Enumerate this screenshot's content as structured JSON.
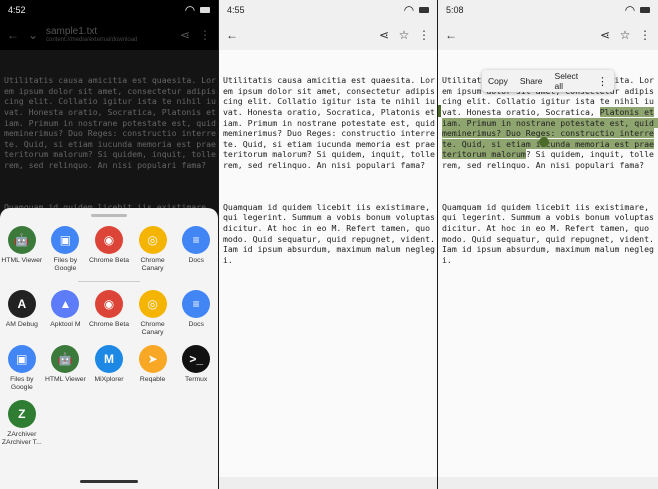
{
  "panel1": {
    "status": {
      "time": "4:52"
    },
    "appbar": {
      "title": "sample1.txt",
      "subtitle": "content://media/external/download"
    },
    "text": [
      "Utilitatis causa amicitia est quaesita. Lorem ipsum dolor sit amet, consectetur adipiscing elit. Collatio igitur ista te nihil iuvat. Honesta oratio, Socratica, Platonis etiam. Primum in nostrane potestate est, quid meminerimus? Duo Reges: constructio interrete. Quid, si etiam iucunda memoria est praeteritorum malorum? Si quidem, inquit, tollerem, sed relinquo. An nisi populari fama?",
      "Quamquam id quidem licebit iis existimare, qui legerint. Summum a vobis bonum voluptas dicitur. At hoc in eo M. Refert tamen, quo modo. Quid sequatur, quid repugnet, vident. Iam id ipsum absurdum, maximum malum neglegi."
    ],
    "share_apps_row1": [
      {
        "label": "HTML Viewer",
        "icon": "android-icon",
        "color": "#3c7a3c"
      },
      {
        "label": "Files by Google",
        "icon": "files-icon",
        "color": "#4285f4"
      },
      {
        "label": "Chrome Beta",
        "icon": "chrome-icon",
        "color": "#db4437"
      },
      {
        "label": "Chrome Canary",
        "icon": "chrome-canary-icon",
        "color": "#f4b400"
      },
      {
        "label": "Docs",
        "icon": "docs-icon",
        "color": "#4285f4"
      }
    ],
    "share_apps_row2": [
      {
        "label": "AM Debug",
        "icon": "am-icon",
        "color": "#222222"
      },
      {
        "label": "Apktool M",
        "icon": "apktool-icon",
        "color": "#5c7cfa"
      },
      {
        "label": "Chrome Beta",
        "icon": "chrome-icon",
        "color": "#db4437"
      },
      {
        "label": "Chrome Canary",
        "icon": "chrome-canary-icon",
        "color": "#f4b400"
      },
      {
        "label": "Docs",
        "icon": "docs-icon",
        "color": "#4285f4"
      }
    ],
    "share_apps_row3": [
      {
        "label": "Files by Google",
        "icon": "files-icon",
        "color": "#4285f4"
      },
      {
        "label": "HTML Viewer",
        "icon": "android-icon",
        "color": "#3c7a3c"
      },
      {
        "label": "MiXplorer",
        "icon": "mixplorer-icon",
        "color": "#1e88e5"
      },
      {
        "label": "Reqable",
        "icon": "reqable-icon",
        "color": "#f9a825"
      },
      {
        "label": "Termux",
        "icon": "termux-icon",
        "color": "#111111"
      }
    ],
    "share_apps_row4": [
      {
        "label": "ZArchiver ZArchiver T...",
        "icon": "zarchiver-icon",
        "color": "#2e7d32"
      }
    ]
  },
  "panel2": {
    "status": {
      "time": "4:55"
    },
    "text": [
      "Utilitatis causa amicitia est quaesita. Lorem ipsum dolor sit amet, consectetur adipiscing elit. Collatio igitur ista te nihil iuvat. Honesta oratio, Socratica, Platonis etiam. Primum in nostrane potestate est, quid meminerimus? Duo Reges: constructio interrete. Quid, si etiam iucunda memoria est praeteritorum malorum? Si quidem, inquit, tollerem, sed relinquo. An nisi populari fama?",
      "Quamquam id quidem licebit iis existimare, qui legerint. Summum a vobis bonum voluptas dicitur. At hoc in eo M. Refert tamen, quo modo. Quid sequatur, quid repugnet, vident. Iam id ipsum absurdum, maximum malum neglegi."
    ]
  },
  "panel3": {
    "status": {
      "time": "5:08"
    },
    "text_before": "Utilitatis causa amicitia est quaesita. Lorem ipsum dolor sit amet, consectetur adipiscing elit. Collatio igitur ista te nihil iuvat. Honesta oratio, Socratica, ",
    "text_selected": "Platonis etiam. Primum in nostrane potestate est, quid meminerimus? Duo Reges: constructio interrete. Quid, si etiam iucunda memoria est praeteritorum malorum",
    "text_after": "? Si quidem, inquit, tollerem, sed relinquo. An nisi populari fama?",
    "text2": "Quamquam id quidem licebit iis existimare, qui legerint. Summum a vobis bonum voluptas dicitur. At hoc in eo M. Refert tamen, quo modo. Quid sequatur, quid repugnet, vident. Iam id ipsum absurdum, maximum malum neglegi.",
    "popup": {
      "copy": "Copy",
      "share": "Share",
      "select_all": "Select all"
    },
    "highlight_color": "#8fa56f"
  }
}
